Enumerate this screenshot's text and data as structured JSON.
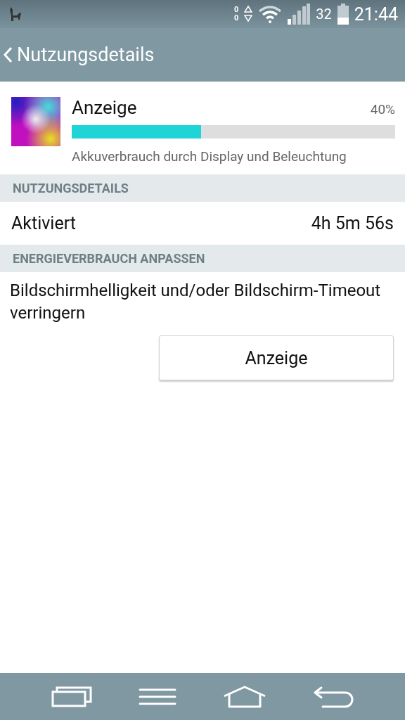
{
  "status_bar": {
    "traffic_up": "0",
    "traffic_down": "0",
    "battery": "32",
    "time": "21:44"
  },
  "app_bar": {
    "title": "Nutzungsdetails"
  },
  "usage_item": {
    "name": "Anzeige",
    "percent": "40%",
    "level": 0.4,
    "description": "Akkuverbrauch durch Display und Beleuchtung"
  },
  "sections": [
    {
      "header": "NUTZUNGSDETAILS",
      "rows": [
        {
          "label": "Aktiviert",
          "value": "4h 5m 56s"
        }
      ]
    },
    {
      "header": "ENERGIEVERBRAUCH ANPASSEN",
      "text": "Bildschirmhelligkeit und/oder Bildschirm-Timeout verringern",
      "button": "Anzeige"
    }
  ]
}
